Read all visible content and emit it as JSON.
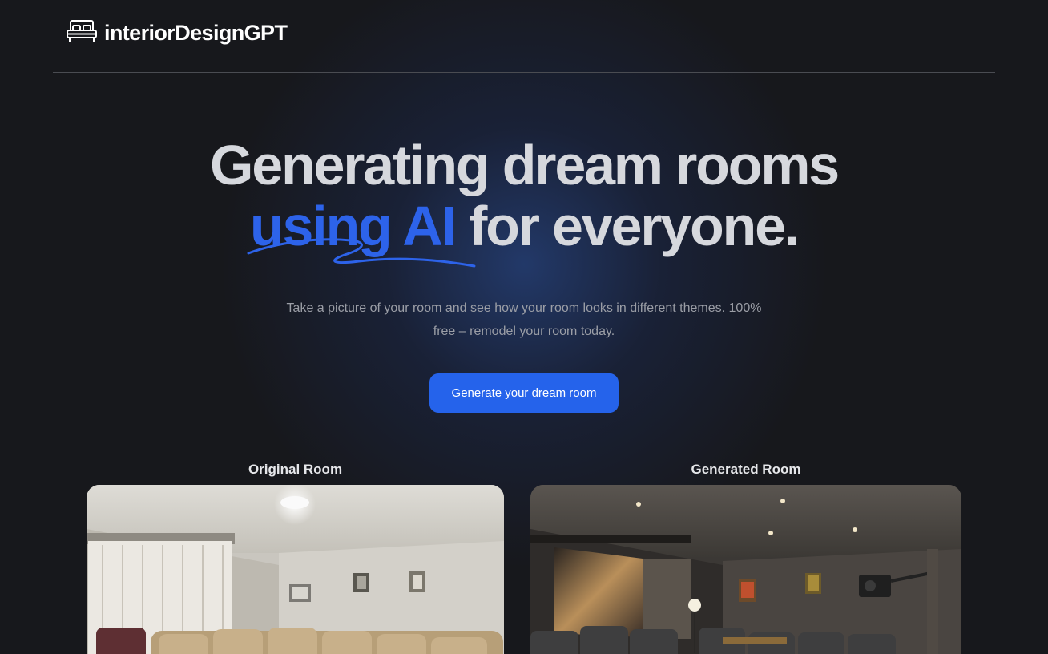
{
  "header": {
    "logo_text": "interiorDesignGPT",
    "logo_icon": "bed-icon"
  },
  "hero": {
    "title_line1": "Generating dream rooms",
    "title_accent": "using AI",
    "title_rest": "for everyone.",
    "subtitle": "Take a picture of your room and see how your room looks in different themes. 100% free – remodel your room today.",
    "cta_label": "Generate your dream room"
  },
  "comparison": {
    "original_label": "Original Room",
    "generated_label": "Generated Room"
  },
  "colors": {
    "background": "#17181c",
    "accent": "#2d63ea",
    "button": "#2563eb",
    "glow": "#2c54a8"
  }
}
